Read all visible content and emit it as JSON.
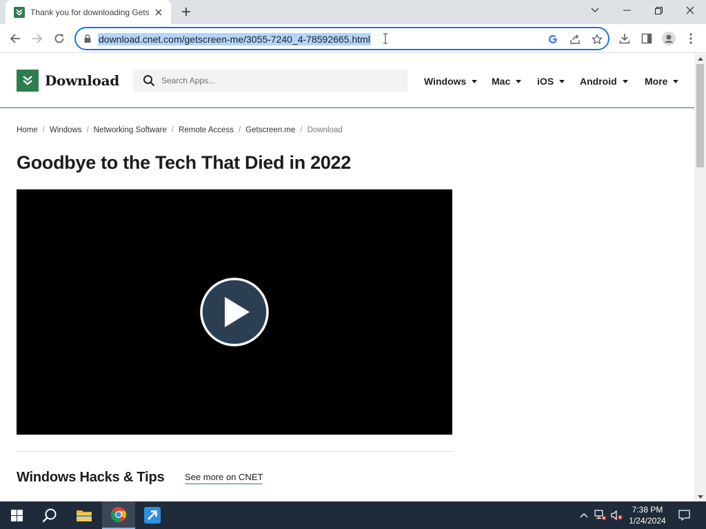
{
  "browser": {
    "tab_title": "Thank you for downloading Getscreen.me",
    "url": "download.cnet.com/getscreen-me/3055-7240_4-78592665.html"
  },
  "site": {
    "logo_text": "Download",
    "search_placeholder": "Search Apps...",
    "nav": [
      {
        "label": "Windows"
      },
      {
        "label": "Mac"
      },
      {
        "label": "iOS"
      },
      {
        "label": "Android"
      },
      {
        "label": "More"
      }
    ]
  },
  "breadcrumb": [
    {
      "label": "Home"
    },
    {
      "label": "Windows"
    },
    {
      "label": "Networking Software"
    },
    {
      "label": "Remote Access"
    },
    {
      "label": "Getscreen.me"
    },
    {
      "label": "Download"
    }
  ],
  "breadcrumb_sep": "/",
  "main": {
    "title": "Goodbye to the Tech That Died in 2022",
    "section_title": "Windows Hacks & Tips",
    "see_more": "See more on CNET"
  },
  "taskbar": {
    "time": "7:38 PM",
    "date": "1/24/2024"
  },
  "colors": {
    "brand_green": "#2e7d4f",
    "omnibox_focus": "#1a73e8",
    "url_selection": "#b3d4fc",
    "taskbar": "#1f2b3a"
  }
}
